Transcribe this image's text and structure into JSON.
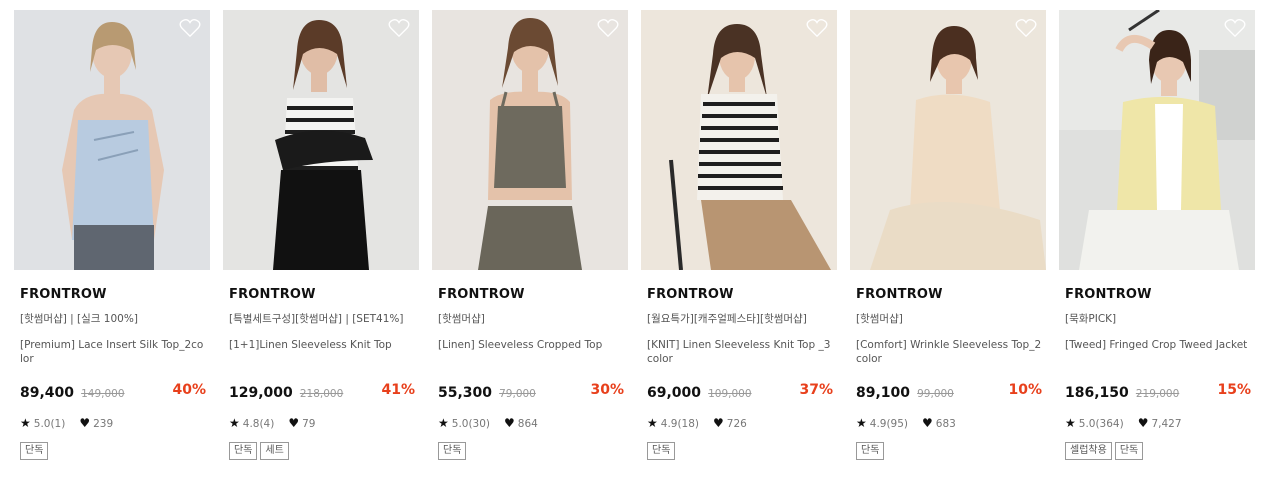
{
  "products": [
    {
      "brand": "FRONTROW",
      "tags": "[핫썸머샵] | [실크 100%]",
      "name": "[Premium] Lace Insert Silk Top_2color",
      "price": "89,400",
      "original_price": "149,000",
      "discount": "40%",
      "rating": "5.0(1)",
      "likes": "239",
      "badges": [
        "단독"
      ]
    },
    {
      "brand": "FRONTROW",
      "tags": "[특별세트구성][핫썸머샵] | [SET41%]",
      "name": "[1+1]Linen Sleeveless Knit Top",
      "price": "129,000",
      "original_price": "218,000",
      "discount": "41%",
      "rating": "4.8(4)",
      "likes": "79",
      "badges": [
        "단독",
        "세트"
      ]
    },
    {
      "brand": "FRONTROW",
      "tags": "[핫썸머샵]",
      "name": "[Linen] Sleeveless Cropped Top",
      "price": "55,300",
      "original_price": "79,000",
      "discount": "30%",
      "rating": "5.0(30)",
      "likes": "864",
      "badges": [
        "단독"
      ]
    },
    {
      "brand": "FRONTROW",
      "tags": "[월요특가][캐주얼페스타][핫썸머샵]",
      "name": "[KNIT] Linen Sleeveless Knit Top _3color",
      "price": "69,000",
      "original_price": "109,000",
      "discount": "37%",
      "rating": "4.9(18)",
      "likes": "726",
      "badges": [
        "단독"
      ]
    },
    {
      "brand": "FRONTROW",
      "tags": "[핫썸머샵]",
      "name": "[Comfort] Wrinkle Sleeveless Top_2color",
      "price": "89,100",
      "original_price": "99,000",
      "discount": "10%",
      "rating": "4.9(95)",
      "likes": "683",
      "badges": [
        "단독"
      ]
    },
    {
      "brand": "FRONTROW",
      "tags": "[묵화PICK]",
      "name": "[Tweed] Fringed Crop Tweed Jacket",
      "price": "186,150",
      "original_price": "219,000",
      "discount": "15%",
      "rating": "5.0(364)",
      "likes": "7,427",
      "badges": [
        "셀럽착용",
        "단독"
      ]
    }
  ],
  "icons": {
    "wishlist": "heart-outline-icon",
    "rating": "star-icon",
    "likes": "heart-filled-icon"
  },
  "colors": {
    "discount": "#e8401c",
    "price": "#111111",
    "muted": "#999999"
  }
}
